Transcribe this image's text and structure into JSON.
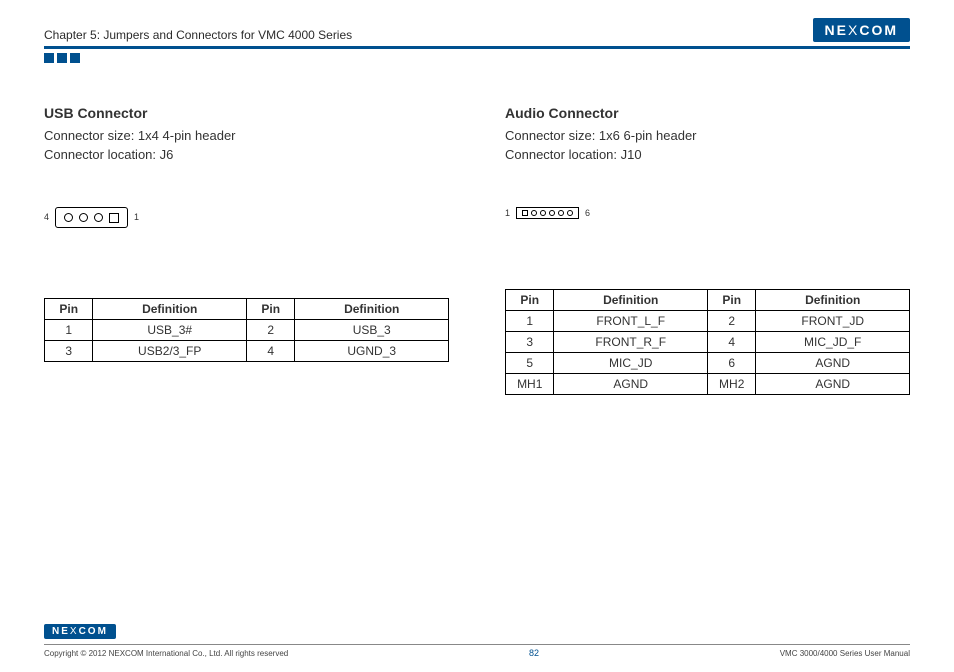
{
  "header": {
    "chapter": "Chapter 5: Jumpers and Connectors for VMC 4000 Series",
    "logo": "NE COM",
    "logo_x": "X"
  },
  "left": {
    "title": "USB Connector",
    "size": "Connector size: 1x4 4-pin header",
    "loc": "Connector location: J6",
    "diagram": {
      "left_label": "4",
      "right_label": "1"
    },
    "headers": {
      "pin": "Pin",
      "def": "Definition"
    },
    "rows": [
      {
        "p1": "1",
        "d1": "USB_3#",
        "p2": "2",
        "d2": "USB_3"
      },
      {
        "p1": "3",
        "d1": "USB2/3_FP",
        "p2": "4",
        "d2": "UGND_3"
      }
    ]
  },
  "right": {
    "title": "Audio Connector",
    "size": "Connector size: 1x6 6-pin header",
    "loc": "Connector location: J10",
    "diagram": {
      "left_label": "1",
      "right_label": "6"
    },
    "headers": {
      "pin": "Pin",
      "def": "Definition"
    },
    "rows": [
      {
        "p1": "1",
        "d1": "FRONT_L_F",
        "p2": "2",
        "d2": "FRONT_JD"
      },
      {
        "p1": "3",
        "d1": "FRONT_R_F",
        "p2": "4",
        "d2": "MIC_JD_F"
      },
      {
        "p1": "5",
        "d1": "MIC_JD",
        "p2": "6",
        "d2": "AGND"
      },
      {
        "p1": "MH1",
        "d1": "AGND",
        "p2": "MH2",
        "d2": "AGND"
      }
    ]
  },
  "footer": {
    "copyright": "Copyright © 2012 NEXCOM International Co., Ltd. All rights reserved",
    "page": "82",
    "manual": "VMC 3000/4000 Series User Manual",
    "logo": "NE COM",
    "logo_x": "X"
  }
}
